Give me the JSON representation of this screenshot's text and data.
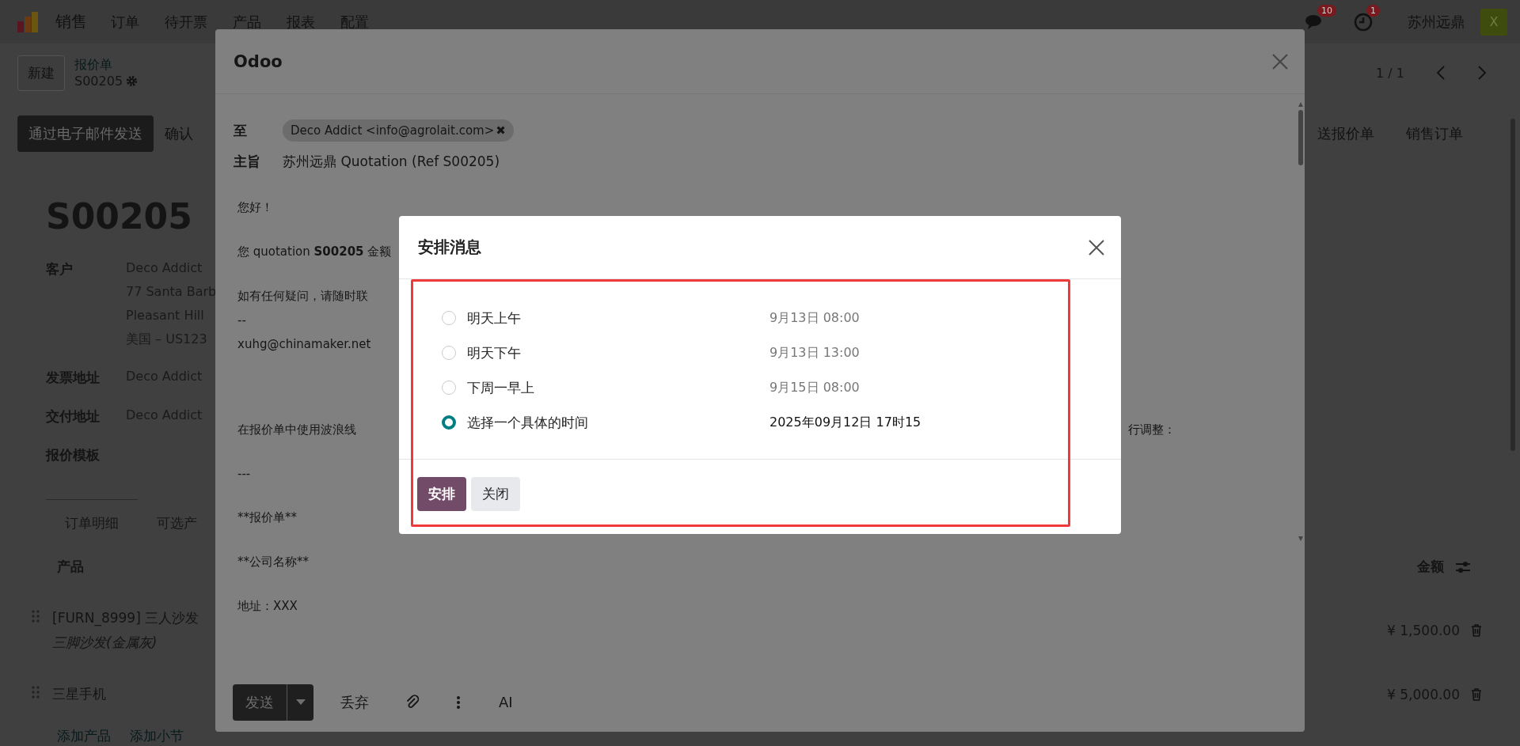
{
  "navbar": {
    "app_name": "销售",
    "menu": [
      {
        "label": "订单"
      },
      {
        "label": "待开票"
      },
      {
        "label": "产品"
      },
      {
        "label": "报表"
      },
      {
        "label": "配置"
      }
    ],
    "messages_badge": "10",
    "activities_badge": "1",
    "company": "苏州远鼎",
    "avatar": "X"
  },
  "control_panel": {
    "new_button": "新建",
    "breadcrumb": "报价单",
    "record": "S00205",
    "pager": "1 / 1"
  },
  "action_bar": {
    "buttons": [
      {
        "label": "通过电子邮件发送",
        "kind": "primary"
      },
      {
        "label": "确认",
        "kind": "plain"
      }
    ],
    "status": [
      "送报价单",
      "销售订单"
    ]
  },
  "form": {
    "title": "S00205",
    "fields": [
      {
        "label": "客户",
        "lines": [
          "Deco Addict",
          "77 Santa Barb",
          "Pleasant Hill",
          "美国 – US123"
        ]
      },
      {
        "label": "发票地址",
        "lines": [
          "Deco Addict"
        ]
      },
      {
        "label": "交付地址",
        "lines": [
          "Deco Addict"
        ]
      },
      {
        "label": "报价模板"
      }
    ],
    "tabs": [
      {
        "label": "订单明细",
        "selected": true
      },
      {
        "label": "可选产",
        "selected": false
      }
    ],
    "table": {
      "columns": [
        "产品",
        "金额"
      ],
      "rows": [
        {
          "product": "[FURN_8999] 三人沙发",
          "description": "三脚沙发(金属灰)",
          "amount": "¥ 1,500.00"
        },
        {
          "product": "三星手机",
          "amount": "¥ 5,000.00"
        }
      ]
    },
    "add_links": [
      "添加产品",
      "添加小节"
    ]
  },
  "mail_dialog": {
    "title": "Odoo",
    "to_label": "至",
    "recipient": "Deco Addict <info@agrolait.com>",
    "remove": "✖",
    "subject_label": "主旨",
    "subject": "苏州远鼎 Quotation (Ref S00205)",
    "body": [
      {
        "kind": "text",
        "text": "您好！"
      },
      {
        "kind": "rich",
        "text": "您 quotation **S00205** 金额"
      },
      {
        "kind": "text",
        "text": "如有任何疑问，请随时联"
      },
      {
        "kind": "signature",
        "text": "--"
      },
      {
        "kind": "signature",
        "text": "xuhg@chinamaker.net"
      },
      {
        "kind": "split",
        "text": "在报价单中使用波浪线",
        "right": "行调整："
      },
      {
        "kind": "text",
        "text": "---"
      },
      {
        "kind": "text",
        "text": "**报价单**"
      },
      {
        "kind": "text",
        "text": "**公司名称**"
      },
      {
        "kind": "text",
        "text": "地址：XXX"
      }
    ],
    "send": "发送",
    "discard": "丢弃",
    "ai": "AI"
  },
  "schedule_dialog": {
    "title": "安排消息",
    "options": [
      {
        "label": "明天上午",
        "time": "9月13日 08:00",
        "selected": false
      },
      {
        "label": "明天下午",
        "time": "9月13日 13:00",
        "selected": false
      },
      {
        "label": "下周一早上",
        "time": "9月15日 08:00",
        "selected": false
      },
      {
        "label": "选择一个具体的时间",
        "time": "2025年09月12日 17时15",
        "selected": true
      }
    ],
    "buttons": [
      {
        "label": "安排",
        "kind": "primary"
      },
      {
        "label": "关闭",
        "kind": "secondary"
      }
    ]
  }
}
